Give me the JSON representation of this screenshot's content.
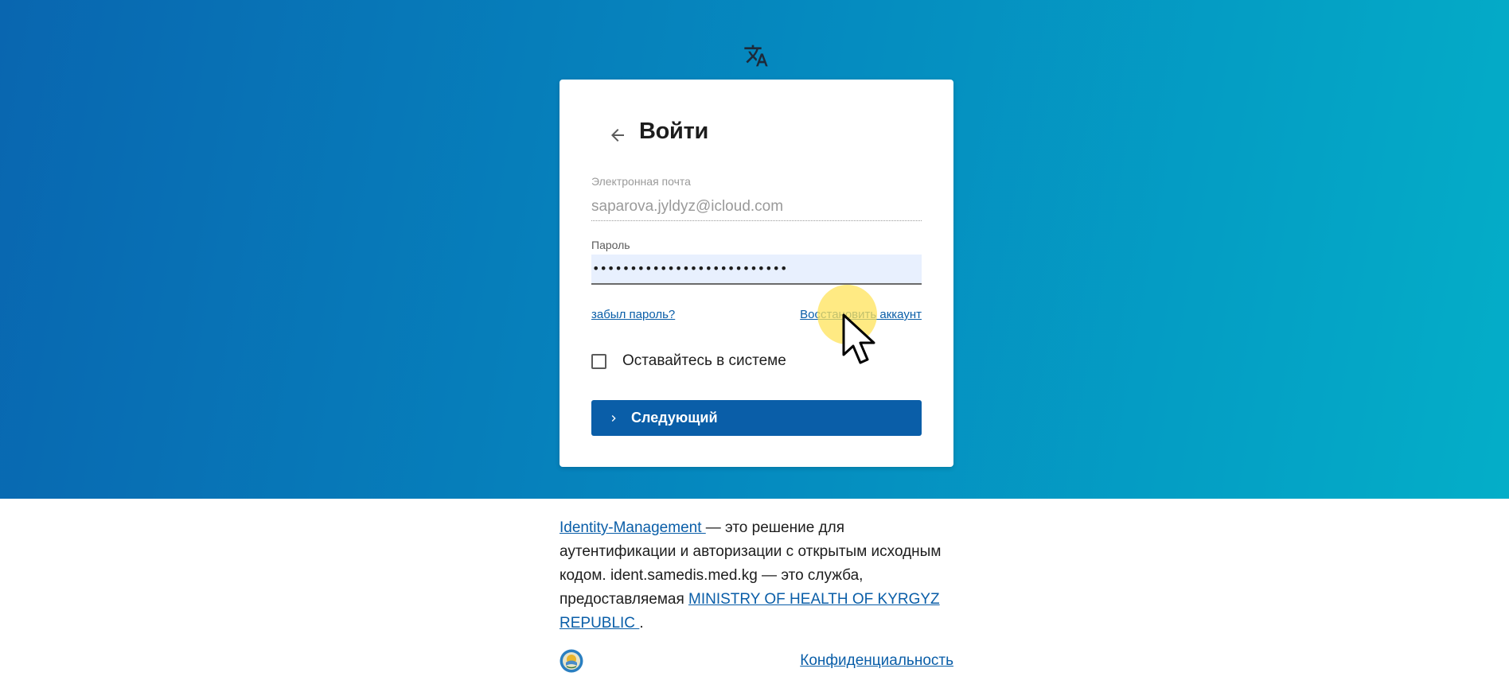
{
  "header": {
    "language_icon": "translate-icon"
  },
  "login": {
    "back_icon": "arrow-left-icon",
    "title": "Войти",
    "email_label": "Электронная почта",
    "email_value": "saparova.jyldyz@icloud.com",
    "password_label": "Пароль",
    "password_value": "••••••••••••••••••••••••••",
    "forgot_password": "забыл пароль?",
    "recover_account": "Восстановить аккаунт",
    "stay_signed_in": "Оставайтесь в системе",
    "stay_signed_in_checked": false,
    "next_icon": "chevron-right-icon",
    "next_button": "Следующий"
  },
  "footer": {
    "idm_link": "Identity-Management ",
    "text_1": " — это решение для аутентификации и авторизации с открытым исходным кодом. ident.samedis.med.kg — это служба, предоставляемая ",
    "ministry_link": "MINISTRY OF HEALTH OF KYRGYZ REPUBLIC ",
    "text_2": ".",
    "emblem_icon": "kyrgyz-emblem-icon",
    "privacy_link": "Конфиденциальность"
  },
  "colors": {
    "primary": "#0a5ea8",
    "gradient_start": "#0966b0",
    "gradient_end": "#04aec8",
    "autofill_bg": "#e8f0fe"
  }
}
